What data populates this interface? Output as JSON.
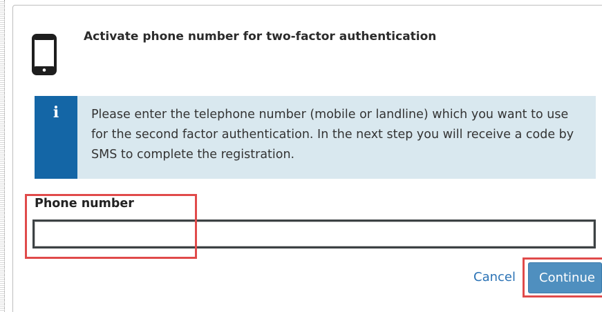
{
  "dialog": {
    "title": "Activate phone number for two-factor authentication",
    "icon": "mobile-phone-icon"
  },
  "info": {
    "icon": "info-icon",
    "glyph": "i",
    "text": "Please enter the telephone number (mobile or landline) which you want to use for the second factor authentication. In the next step you will receive a code by SMS to complete the registration."
  },
  "form": {
    "phone_label": "Phone number",
    "phone_value": "",
    "phone_placeholder": ""
  },
  "actions": {
    "cancel_label": "Cancel",
    "continue_label": "Continue"
  },
  "colors": {
    "info_background": "#d9e8ef",
    "info_stripe": "#1466a6",
    "link": "#2a72b5",
    "button": "#4f8fbf",
    "highlight": "#e04a4a"
  }
}
